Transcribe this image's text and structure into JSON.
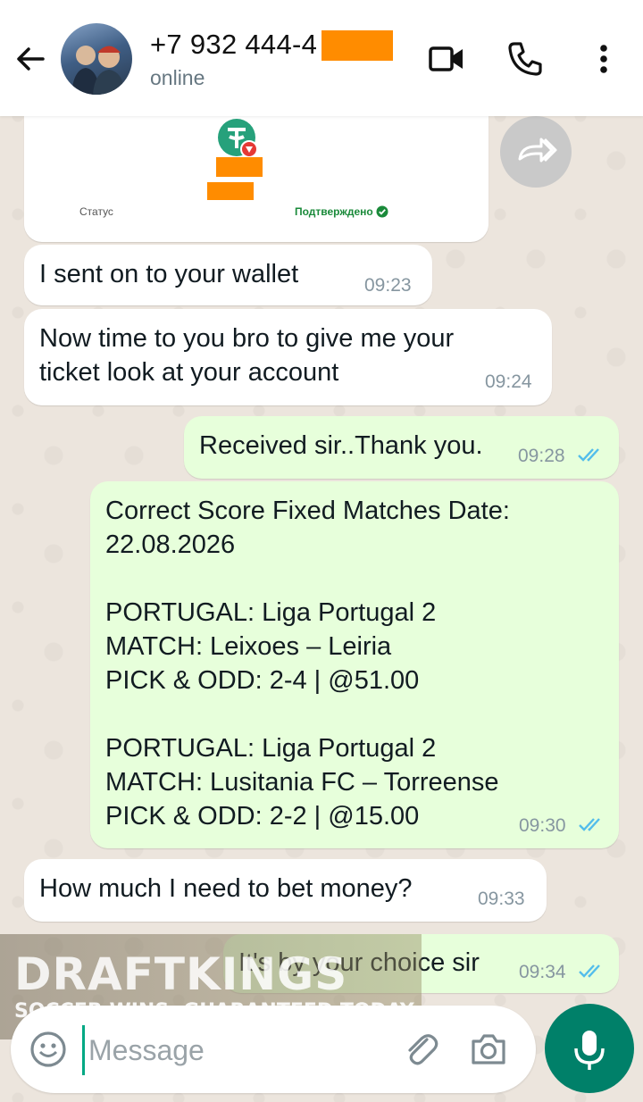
{
  "header": {
    "contact_name": "+7 932 444-4",
    "status": "online"
  },
  "receipt": {
    "status_label": "Статус",
    "status_value": "Подтверждено"
  },
  "messages": [
    {
      "text": "I sent on to your wallet",
      "time": "09:23"
    },
    {
      "text": "Now time to you bro to give me your\nticket look at your account",
      "time": "09:24"
    },
    {
      "text": "Received sir..Thank you.",
      "time": "09:28"
    },
    {
      "text": "Correct Score Fixed Matches Date:\n22.08.2026\n\nPORTUGAL: Liga Portugal 2\nMATCH: Leixoes – Leiria\nPICK & ODD: 2-4 | @51.00\n\nPORTUGAL: Liga Portugal 2\nMATCH: Lusitania FC – Torreense\nPICK & ODD: 2-2 | @15.00",
      "time": "09:30"
    },
    {
      "text": "How much I need to bet money?",
      "time": "09:33"
    },
    {
      "text": "It's by your choice sir",
      "time": "09:34"
    }
  ],
  "ad": {
    "logo": "DRAFTKINGS",
    "tagline": "SOCCER WINS, GUARANTEED TODAY"
  },
  "composer": {
    "placeholder": "Message"
  },
  "colors": {
    "accent": "#008069",
    "outgoing_bubble": "#e7ffdb",
    "incoming_bubble": "#ffffff",
    "read_ticks": "#53bdeb",
    "redaction": "#ff8c00",
    "tether_green": "#26a17b"
  },
  "icons": [
    "back-arrow-icon",
    "video-call-icon",
    "phone-icon",
    "more-vert-icon",
    "forward-icon",
    "double-check-icon",
    "emoji-icon",
    "attach-icon",
    "camera-icon",
    "mic-icon"
  ]
}
